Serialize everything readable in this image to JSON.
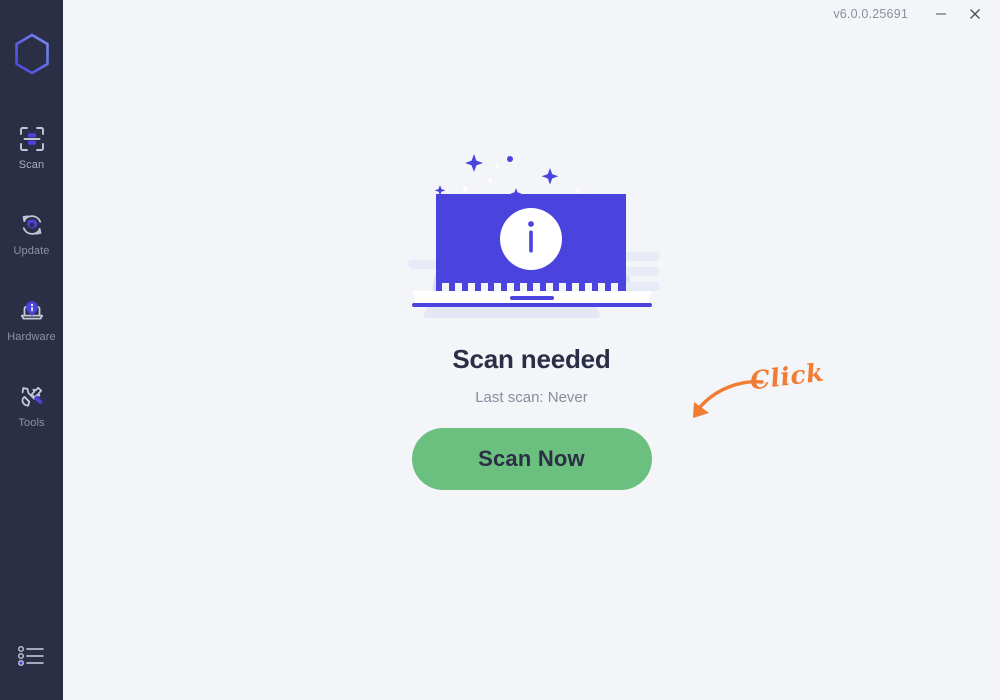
{
  "window": {
    "version": "v6.0.0.25691",
    "minimize_label": "—",
    "close_label": "×"
  },
  "sidebar": {
    "logo_name": "app-logo",
    "items": [
      {
        "id": "scan",
        "label": "Scan",
        "icon": "scan-icon",
        "active": true
      },
      {
        "id": "update",
        "label": "Update",
        "icon": "update-icon",
        "active": false
      },
      {
        "id": "hardware",
        "label": "Hardware",
        "icon": "hardware-icon",
        "active": false
      },
      {
        "id": "tools",
        "label": "Tools",
        "icon": "tools-icon",
        "active": false
      }
    ],
    "menu_icon": "list-menu-icon"
  },
  "main": {
    "illustration": "laptop-info-illustration",
    "headline": "Scan needed",
    "subline": "Last scan: Never",
    "scan_button": "Scan Now",
    "annotation": {
      "text": "Click",
      "arrow": "curved-arrow-icon"
    }
  },
  "colors": {
    "sidebar_bg": "#2b2f45",
    "content_bg": "#f4f5f9",
    "accent_blue": "#4a43dd",
    "button_green": "#6cc07f",
    "annotation_orange": "#f07d33",
    "text_dark": "#2b2f45",
    "text_muted": "#878c9c"
  }
}
